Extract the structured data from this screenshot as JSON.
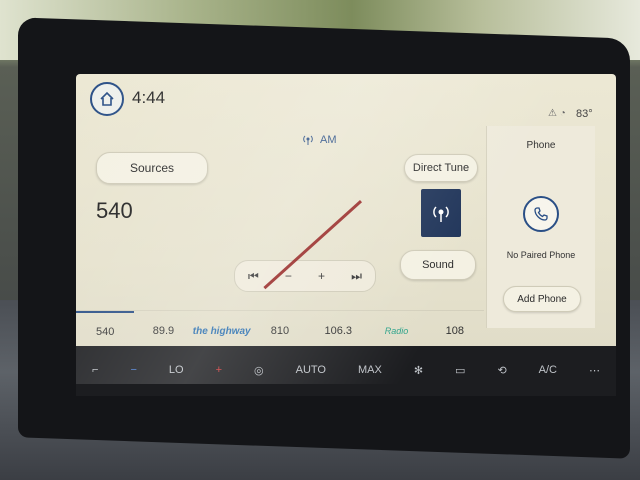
{
  "header": {
    "time": "4:44",
    "temperature": "83°",
    "status_icons": "⚠ ◔"
  },
  "source": {
    "band": "AM",
    "sources_label": "Sources",
    "direct_tune_label": "Direct Tune",
    "sound_label": "Sound",
    "frequency": "540"
  },
  "controls": {
    "prev": "⏮",
    "minus": "−",
    "plus": "+",
    "next": "⏭"
  },
  "presets": [
    {
      "label": "540"
    },
    {
      "label": "89.9"
    },
    {
      "label": "the highway"
    },
    {
      "label": "810"
    },
    {
      "label": "106.3"
    },
    {
      "label": "Radio"
    },
    {
      "label": "108"
    }
  ],
  "phone": {
    "title": "Phone",
    "status": "No Paired Phone",
    "add_label": "Add Phone"
  },
  "climate": {
    "left_temp": "LO",
    "auto_label": "AUTO",
    "max_label": "MAX",
    "ac_label": "A/C"
  }
}
